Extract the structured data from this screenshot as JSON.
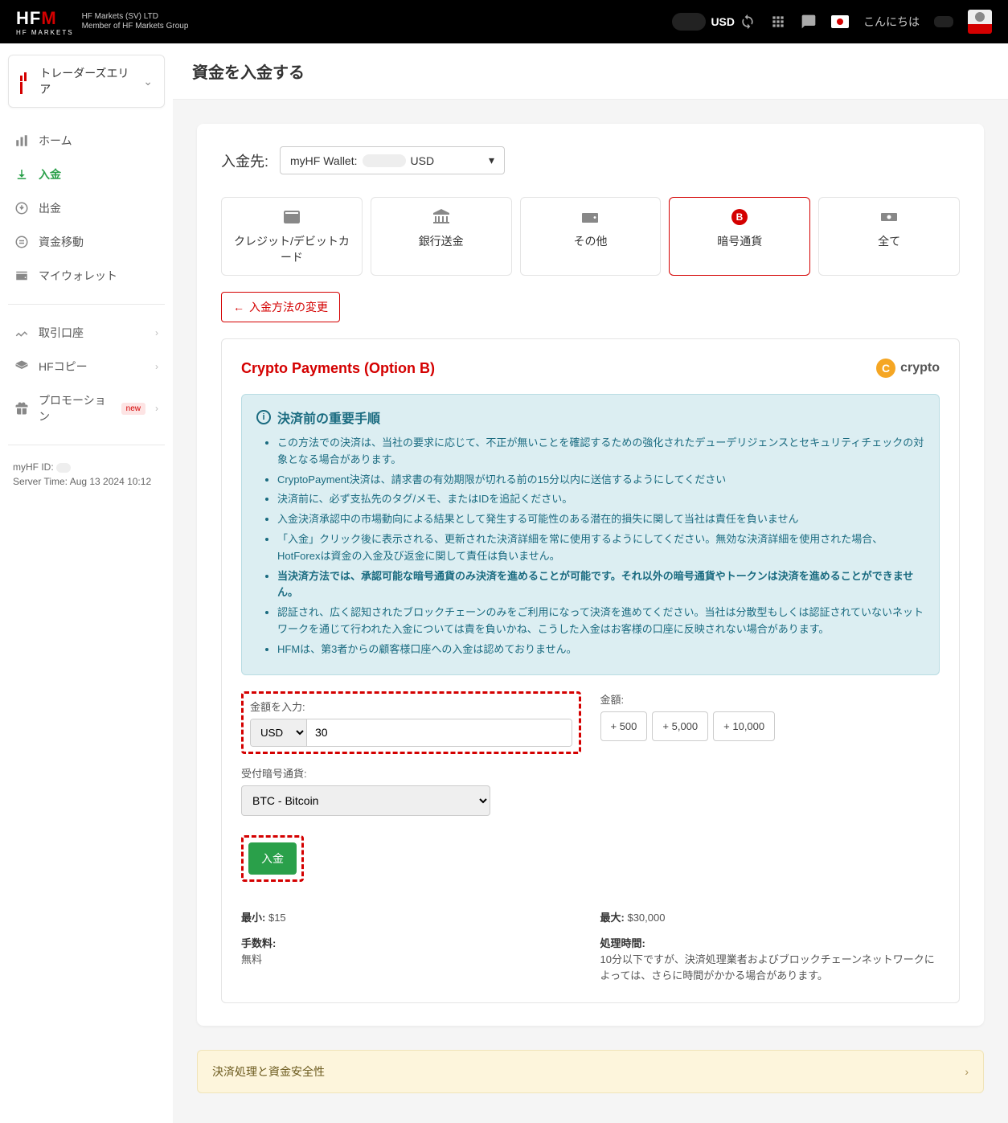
{
  "header": {
    "logo_main_prefix": "HF",
    "logo_main_suffix": "M",
    "logo_sub": "HF MARKETS",
    "company_line1": "HF Markets (SV) LTD",
    "company_line2": "Member of HF Markets Group",
    "currency": "USD",
    "greeting": "こんにちは"
  },
  "sidebar": {
    "area_btn": "トレーダーズエリア",
    "items": [
      {
        "label": "ホーム"
      },
      {
        "label": "入金"
      },
      {
        "label": "出金"
      },
      {
        "label": "資金移動"
      },
      {
        "label": "マイウォレット"
      }
    ],
    "sub_items": [
      {
        "label": "取引口座"
      },
      {
        "label": "HFコピー"
      },
      {
        "label": "プロモーション",
        "badge": "new"
      }
    ],
    "footer_id_label": "myHF ID:",
    "footer_time_label": "Server Time:",
    "footer_time_value": "Aug 13 2024 10:12"
  },
  "page_title": "資金を入金する",
  "dest": {
    "label": "入金先:",
    "wallet_prefix": "myHF Wallet:",
    "currency": "USD"
  },
  "tabs": [
    {
      "label": "クレジット/デビットカード"
    },
    {
      "label": "銀行送金"
    },
    {
      "label": "その他"
    },
    {
      "label": "暗号通貨"
    },
    {
      "label": "全て"
    }
  ],
  "back_btn": "入金方法の変更",
  "card_title": "Crypto Payments (Option B)",
  "crypto_logo_text": "crypto",
  "alert": {
    "title": "決済前の重要手順",
    "items": [
      "この方法での決済は、当社の要求に応じて、不正が無いことを確認するための強化されたデューデリジェンスとセキュリティチェックの対象となる場合があります。",
      "CryptoPayment決済は、請求書の有効期限が切れる前の15分以内に送信するようにしてください",
      "決済前に、必ず支払先のタグ/メモ、またはIDを追記ください。",
      "入金決済承認中の市場動向による結果として発生する可能性のある潜在的損失に関して当社は責任を負いません",
      "「入金」クリック後に表示される、更新された決済詳細を常に使用するようにしてください。無効な決済詳細を使用された場合、HotForexは資金の入金及び返金に関して責任は負いません。",
      "当決済方法では、承認可能な暗号通貨のみ決済を進めることが可能です。それ以外の暗号通貨やトークンは決済を進めることができません。",
      "認証され、広く認知されたブロックチェーンのみをご利用になって決済を進めてください。当社は分散型もしくは認証されていないネットワークを通じて行われた入金については責を負いかね、こうした入金はお客様の口座に反映されない場合があります。",
      "HFMは、第3者からの顧客様口座への入金は認めておりません。"
    ]
  },
  "form": {
    "amount_label": "金額を入力:",
    "quick_label": "金額:",
    "currency_opt": "USD",
    "amount_value": "30",
    "quick": [
      "+ 500",
      "+ 5,000",
      "+ 10,000"
    ],
    "crypto_label": "受付暗号通貨:",
    "crypto_opt": "BTC - Bitcoin",
    "submit": "入金"
  },
  "info": {
    "min_k": "最小:",
    "min_v": "$15",
    "max_k": "最大:",
    "max_v": "$30,000",
    "fee_k": "手数料:",
    "fee_v": "無料",
    "time_k": "処理時間:",
    "time_v": "10分以下ですが、決済処理業者およびブロックチェーンネットワークによっては、さらに時間がかかる場合があります。"
  },
  "collapse_title": "決済処理と資金安全性"
}
